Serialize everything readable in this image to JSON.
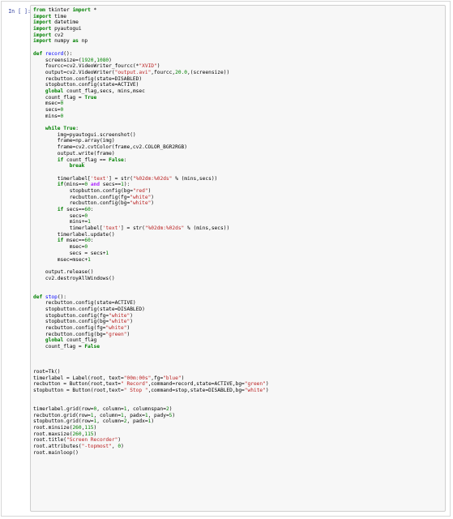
{
  "cell": {
    "prompt": "In [ ]:",
    "code_lines": [
      [
        [
          "kw",
          "from"
        ],
        [
          "tx",
          " tkinter "
        ],
        [
          "kw",
          "import"
        ],
        [
          "tx",
          " *"
        ]
      ],
      [
        [
          "kw",
          "import"
        ],
        [
          "tx",
          " time"
        ]
      ],
      [
        [
          "kw",
          "import"
        ],
        [
          "tx",
          " datetime"
        ]
      ],
      [
        [
          "kw",
          "import"
        ],
        [
          "tx",
          " pyautogui"
        ]
      ],
      [
        [
          "kw",
          "import"
        ],
        [
          "tx",
          " cv2"
        ]
      ],
      [
        [
          "kw",
          "import"
        ],
        [
          "tx",
          " numpy "
        ],
        [
          "kw",
          "as"
        ],
        [
          "tx",
          " np"
        ]
      ],
      [
        [
          "tx",
          ""
        ]
      ],
      [
        [
          "kw",
          "def"
        ],
        [
          "tx",
          " "
        ],
        [
          "nm",
          "record"
        ],
        [
          "tx",
          "():"
        ]
      ],
      [
        [
          "tx",
          "    screensize=("
        ],
        [
          "nu",
          "1920"
        ],
        [
          "tx",
          ","
        ],
        [
          "nu",
          "1080"
        ],
        [
          "tx",
          ")"
        ]
      ],
      [
        [
          "tx",
          "    fourcc=cv2.VideoWriter_fourcc(*"
        ],
        [
          "st",
          "\"XVID\""
        ],
        [
          "tx",
          ")"
        ]
      ],
      [
        [
          "tx",
          "    output=cv2.VideoWriter("
        ],
        [
          "st",
          "\"output.avi\""
        ],
        [
          "tx",
          ",fourcc,"
        ],
        [
          "nu",
          "20.0"
        ],
        [
          "tx",
          ",(screensize))"
        ]
      ],
      [
        [
          "tx",
          "    recbutton.config(state=DISABLED)"
        ]
      ],
      [
        [
          "tx",
          "    stopbutton.config(state=ACTIVE)"
        ]
      ],
      [
        [
          "tx",
          "    "
        ],
        [
          "kw",
          "global"
        ],
        [
          "tx",
          " count_flag,secs, mins,msec"
        ]
      ],
      [
        [
          "tx",
          "    count_flag = "
        ],
        [
          "kw",
          "True"
        ]
      ],
      [
        [
          "tx",
          "    msec="
        ],
        [
          "nu",
          "0"
        ]
      ],
      [
        [
          "tx",
          "    secs="
        ],
        [
          "nu",
          "0"
        ]
      ],
      [
        [
          "tx",
          "    mins="
        ],
        [
          "nu",
          "0"
        ]
      ],
      [
        [
          "tx",
          ""
        ]
      ],
      [
        [
          "tx",
          "    "
        ],
        [
          "kw",
          "while"
        ],
        [
          "tx",
          " "
        ],
        [
          "kw",
          "True"
        ],
        [
          "tx",
          ":"
        ]
      ],
      [
        [
          "tx",
          "        img=pyautogui.screenshot()"
        ]
      ],
      [
        [
          "tx",
          "        frame=np.array(img)"
        ]
      ],
      [
        [
          "tx",
          "        frame=cv2.cvtColor(frame,cv2.COLOR_BGR2RGB)"
        ]
      ],
      [
        [
          "tx",
          "        output.write(frame)"
        ]
      ],
      [
        [
          "tx",
          "        "
        ],
        [
          "kw",
          "if"
        ],
        [
          "tx",
          " count_flag == "
        ],
        [
          "kw",
          "False"
        ],
        [
          "tx",
          ":"
        ]
      ],
      [
        [
          "tx",
          "            "
        ],
        [
          "kw",
          "break"
        ]
      ],
      [
        [
          "tx",
          ""
        ]
      ],
      [
        [
          "tx",
          "        timerlabel["
        ],
        [
          "st",
          "'text'"
        ],
        [
          "tx",
          "] = str("
        ],
        [
          "st",
          "\"%02dm:%02ds\""
        ],
        [
          "tx",
          " % (mins,secs))"
        ]
      ],
      [
        [
          "tx",
          "        "
        ],
        [
          "kw",
          "if"
        ],
        [
          "tx",
          "(mins=="
        ],
        [
          "nu",
          "0"
        ],
        [
          "tx",
          " "
        ],
        [
          "op",
          "and"
        ],
        [
          "tx",
          " secs=="
        ],
        [
          "nu",
          "1"
        ],
        [
          "tx",
          "):"
        ]
      ],
      [
        [
          "tx",
          "            stopbutton.config(bg="
        ],
        [
          "st",
          "\"red\""
        ],
        [
          "tx",
          ")"
        ]
      ],
      [
        [
          "tx",
          "            recbutton.config(fg="
        ],
        [
          "st",
          "\"white\""
        ],
        [
          "tx",
          ")"
        ]
      ],
      [
        [
          "tx",
          "            recbutton.config(bg="
        ],
        [
          "st",
          "\"white\""
        ],
        [
          "tx",
          ")"
        ]
      ],
      [
        [
          "tx",
          "        "
        ],
        [
          "kw",
          "if"
        ],
        [
          "tx",
          " secs=="
        ],
        [
          "nu",
          "60"
        ],
        [
          "tx",
          ":"
        ]
      ],
      [
        [
          "tx",
          "            secs="
        ],
        [
          "nu",
          "0"
        ]
      ],
      [
        [
          "tx",
          "            mins+="
        ],
        [
          "nu",
          "1"
        ]
      ],
      [
        [
          "tx",
          "            timerlabel["
        ],
        [
          "st",
          "'text'"
        ],
        [
          "tx",
          "] = str("
        ],
        [
          "st",
          "\"%02dm:%02ds\""
        ],
        [
          "tx",
          " % (mins,secs))"
        ]
      ],
      [
        [
          "tx",
          "        timerlabel.update()"
        ]
      ],
      [
        [
          "tx",
          "        "
        ],
        [
          "kw",
          "if"
        ],
        [
          "tx",
          " msec=="
        ],
        [
          "nu",
          "60"
        ],
        [
          "tx",
          ":"
        ]
      ],
      [
        [
          "tx",
          "            msec="
        ],
        [
          "nu",
          "0"
        ]
      ],
      [
        [
          "tx",
          "            secs = secs+"
        ],
        [
          "nu",
          "1"
        ]
      ],
      [
        [
          "tx",
          "        msec=msec+"
        ],
        [
          "nu",
          "1"
        ]
      ],
      [
        [
          "tx",
          ""
        ]
      ],
      [
        [
          "tx",
          "    output.release()"
        ]
      ],
      [
        [
          "tx",
          "    cv2.destroyAllWindows()"
        ]
      ],
      [
        [
          "tx",
          ""
        ]
      ],
      [
        [
          "tx",
          ""
        ]
      ],
      [
        [
          "kw",
          "def"
        ],
        [
          "tx",
          " "
        ],
        [
          "nm",
          "stop"
        ],
        [
          "tx",
          "():"
        ]
      ],
      [
        [
          "tx",
          "    recbutton.config(state=ACTIVE)"
        ]
      ],
      [
        [
          "tx",
          "    stopbutton.config(state=DISABLED)"
        ]
      ],
      [
        [
          "tx",
          "    stopbutton.config(fg="
        ],
        [
          "st",
          "\"white\""
        ],
        [
          "tx",
          ")"
        ]
      ],
      [
        [
          "tx",
          "    stopbutton.config(bg="
        ],
        [
          "st",
          "\"white\""
        ],
        [
          "tx",
          ")"
        ]
      ],
      [
        [
          "tx",
          "    recbutton.config(fg="
        ],
        [
          "st",
          "\"white\""
        ],
        [
          "tx",
          ")"
        ]
      ],
      [
        [
          "tx",
          "    recbutton.config(bg="
        ],
        [
          "st",
          "\"green\""
        ],
        [
          "tx",
          ")"
        ]
      ],
      [
        [
          "tx",
          "    "
        ],
        [
          "kw",
          "global"
        ],
        [
          "tx",
          " count_flag"
        ]
      ],
      [
        [
          "tx",
          "    count_flag = "
        ],
        [
          "kw",
          "False"
        ]
      ],
      [
        [
          "tx",
          ""
        ]
      ],
      [
        [
          "tx",
          ""
        ]
      ],
      [
        [
          "tx",
          ""
        ]
      ],
      [
        [
          "tx",
          "root=Tk()"
        ]
      ],
      [
        [
          "tx",
          "timerlabel = Label(root, text="
        ],
        [
          "st",
          "\"00m:00s\""
        ],
        [
          "tx",
          ",fg="
        ],
        [
          "st",
          "\"blue\""
        ],
        [
          "tx",
          ")"
        ]
      ],
      [
        [
          "tx",
          "recbutton = Button(root,text="
        ],
        [
          "st",
          "\" Record\""
        ],
        [
          "tx",
          ",command=record,state=ACTIVE,bg="
        ],
        [
          "st",
          "\"green\""
        ],
        [
          "tx",
          ")"
        ]
      ],
      [
        [
          "tx",
          "stopbutton = Button(root,text="
        ],
        [
          "st",
          "\" Stop \""
        ],
        [
          "tx",
          ",command=stop,state=DISABLED,bg="
        ],
        [
          "st",
          "\"white\""
        ],
        [
          "tx",
          ")"
        ]
      ],
      [
        [
          "tx",
          ""
        ]
      ],
      [
        [
          "tx",
          ""
        ]
      ],
      [
        [
          "tx",
          "timerlabel.grid(row="
        ],
        [
          "nu",
          "0"
        ],
        [
          "tx",
          ", column="
        ],
        [
          "nu",
          "1"
        ],
        [
          "tx",
          ", columnspan="
        ],
        [
          "nu",
          "2"
        ],
        [
          "tx",
          ")"
        ]
      ],
      [
        [
          "tx",
          "recbutton.grid(row="
        ],
        [
          "nu",
          "1"
        ],
        [
          "tx",
          ", column="
        ],
        [
          "nu",
          "1"
        ],
        [
          "tx",
          ", padx="
        ],
        [
          "nu",
          "1"
        ],
        [
          "tx",
          ", pady="
        ],
        [
          "nu",
          "5"
        ],
        [
          "tx",
          ")"
        ]
      ],
      [
        [
          "tx",
          "stopbutton.grid(row="
        ],
        [
          "nu",
          "1"
        ],
        [
          "tx",
          ", column="
        ],
        [
          "nu",
          "2"
        ],
        [
          "tx",
          ", padx="
        ],
        [
          "nu",
          "1"
        ],
        [
          "tx",
          ")"
        ]
      ],
      [
        [
          "tx",
          "root.minsize("
        ],
        [
          "nu",
          "260"
        ],
        [
          "tx",
          ","
        ],
        [
          "nu",
          "115"
        ],
        [
          "tx",
          ")"
        ]
      ],
      [
        [
          "tx",
          "root.maxsize("
        ],
        [
          "nu",
          "260"
        ],
        [
          "tx",
          ","
        ],
        [
          "nu",
          "115"
        ],
        [
          "tx",
          ")"
        ]
      ],
      [
        [
          "tx",
          "root.title("
        ],
        [
          "st",
          "\"Screen Recorder\""
        ],
        [
          "tx",
          ")"
        ]
      ],
      [
        [
          "tx",
          "root.attributes("
        ],
        [
          "st",
          "\"-topmost\""
        ],
        [
          "tx",
          ", "
        ],
        [
          "nu",
          "0"
        ],
        [
          "tx",
          ")"
        ]
      ],
      [
        [
          "tx",
          "root.mainloop()"
        ]
      ]
    ]
  },
  "colors": {
    "keyword": "#008000",
    "string": "#ba2121",
    "function_name": "#0000ff",
    "prompt": "#303f9f",
    "cell_background": "#f7f7f7",
    "cell_border": "#cfcfcf"
  }
}
